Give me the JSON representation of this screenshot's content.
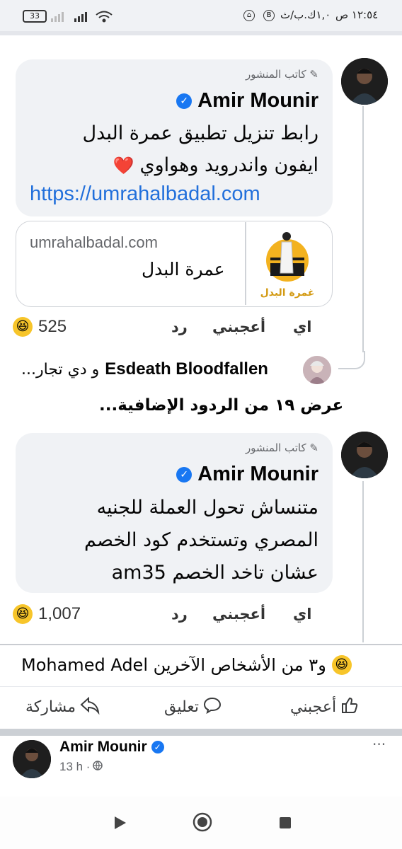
{
  "status_bar": {
    "time": "١٢:٥٤ ص",
    "speed": "١,٠ك.ب/ث",
    "b_icon_letter": "B",
    "battery": "33"
  },
  "comment1": {
    "author_tag": "كاتب المنشور",
    "name": "Amir Mounir",
    "line1": "رابط تنزيل تطبيق عمرة البدل",
    "line2": "ايفون واندرويد وهواوي",
    "heart": "❤️",
    "link": "https://umrahalbadal.com",
    "preview_domain": "umrahalbadal.com",
    "preview_title": "عمرة البدل",
    "preview_logo_text": "غمرة البدل",
    "like": "أعجبني",
    "reply": "رد",
    "more": "اي",
    "reaction_count": "525"
  },
  "reply_preview": {
    "name": "Esdeath Bloodfallen",
    "text": "و دي تجار...",
    "view_more": "عرض ١٩ من الردود الإضافية..."
  },
  "comment2": {
    "author_tag": "كاتب المنشور",
    "name": "Amir Mounir",
    "line1": "متنساش تحول العملة للجنيه",
    "line2": "المصري وتستخدم كود الخصم",
    "line3": "عشان تاخد الخصم am35",
    "like": "أعجبني",
    "reply": "رد",
    "more": "اي",
    "reaction_count": "1,007"
  },
  "post_footer": {
    "reactions_text": "Mohamed Adel و٣ من الأشخاص الآخرين",
    "like_label": "أعجبني",
    "comment_label": "تعليق",
    "share_label": "مشاركة"
  },
  "next_post": {
    "name": "Amir Mounir",
    "time": "13 h ·",
    "more": "···"
  },
  "colors": {
    "link": "#216fdb",
    "verified": "#1877f2",
    "bubble": "#f0f2f5"
  }
}
